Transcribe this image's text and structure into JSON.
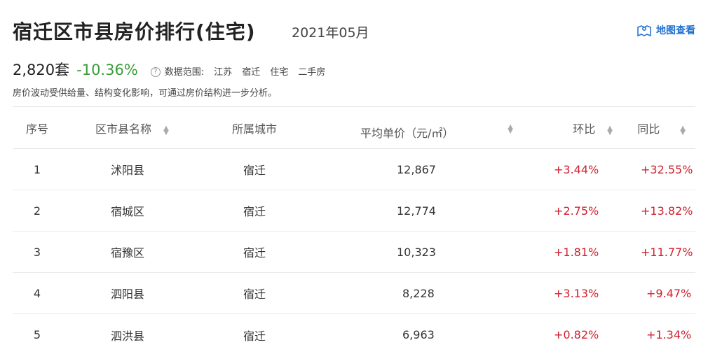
{
  "header": {
    "title": "宿迁区市县房价排行(住宅)",
    "date": "2021年05月",
    "map_link": "地图查看"
  },
  "stats": {
    "count": "2,820套",
    "change": "-10.36%",
    "range_label": "数据范围:",
    "range_items": [
      "江苏",
      "宿迁",
      "住宅",
      "二手房"
    ]
  },
  "note": "房价波动受供给量、结构变化影响，可通过房价结构进一步分析。",
  "table": {
    "headers": {
      "index": "序号",
      "name": "区市县名称",
      "city": "所属城市",
      "price": "平均单价（元/㎡）",
      "mom": "环比",
      "yoy": "同比"
    },
    "rows": [
      {
        "index": "1",
        "name": "沭阳县",
        "city": "宿迁",
        "price": "12,867",
        "mom": "+3.44%",
        "yoy": "+32.55%"
      },
      {
        "index": "2",
        "name": "宿城区",
        "city": "宿迁",
        "price": "12,774",
        "mom": "+2.75%",
        "yoy": "+13.82%"
      },
      {
        "index": "3",
        "name": "宿豫区",
        "city": "宿迁",
        "price": "10,323",
        "mom": "+1.81%",
        "yoy": "+11.77%"
      },
      {
        "index": "4",
        "name": "泗阳县",
        "city": "宿迁",
        "price": "8,228",
        "mom": "+3.13%",
        "yoy": "+9.47%"
      },
      {
        "index": "5",
        "name": "泗洪县",
        "city": "宿迁",
        "price": "6,963",
        "mom": "+0.82%",
        "yoy": "+1.34%"
      }
    ]
  },
  "colors": {
    "change": "#3a9c3a",
    "rise": "#d0202e",
    "link": "#1f6fd0"
  },
  "icons": {
    "map": "map-pin-icon",
    "help": "help-icon",
    "sort": "sort-icon"
  }
}
